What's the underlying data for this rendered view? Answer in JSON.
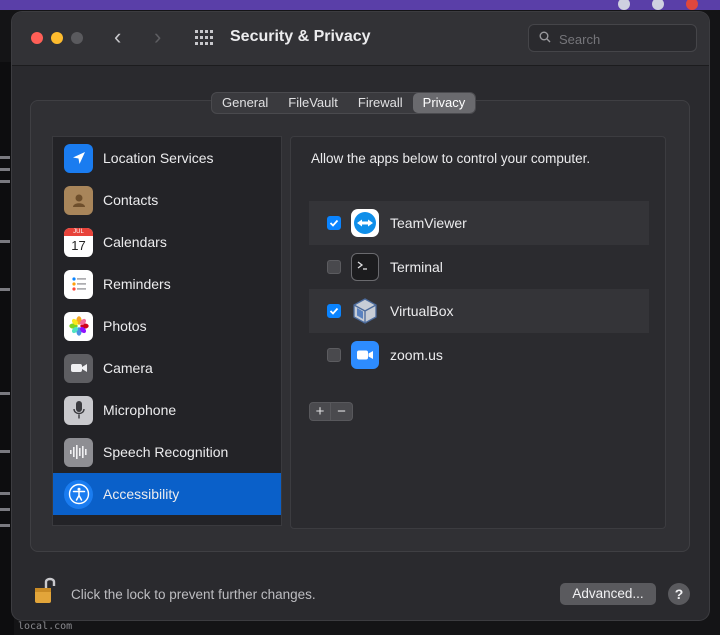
{
  "window": {
    "title": "Security & Privacy",
    "search_placeholder": "Search"
  },
  "tabs": [
    {
      "label": "General",
      "active": false
    },
    {
      "label": "FileVault",
      "active": false
    },
    {
      "label": "Firewall",
      "active": false
    },
    {
      "label": "Privacy",
      "active": true
    }
  ],
  "sidebar": {
    "items": [
      {
        "label": "Location Services",
        "icon": "location-arrow-icon"
      },
      {
        "label": "Contacts",
        "icon": "contacts-icon"
      },
      {
        "label": "Calendars",
        "icon": "calendar-icon",
        "icon_text": "17",
        "icon_month": "JUL"
      },
      {
        "label": "Reminders",
        "icon": "reminders-icon"
      },
      {
        "label": "Photos",
        "icon": "photos-icon"
      },
      {
        "label": "Camera",
        "icon": "camera-icon"
      },
      {
        "label": "Microphone",
        "icon": "microphone-icon"
      },
      {
        "label": "Speech Recognition",
        "icon": "waveform-icon"
      },
      {
        "label": "Accessibility",
        "icon": "accessibility-icon",
        "selected": true
      }
    ]
  },
  "panel": {
    "title": "Allow the apps below to control your computer.",
    "apps": [
      {
        "label": "TeamViewer",
        "checked": true,
        "icon": "teamviewer-icon"
      },
      {
        "label": "Terminal",
        "checked": false,
        "icon": "terminal-icon"
      },
      {
        "label": "VirtualBox",
        "checked": true,
        "icon": "virtualbox-icon"
      },
      {
        "label": "zoom.us",
        "checked": false,
        "icon": "zoom-icon"
      }
    ],
    "add_label": "+",
    "remove_label": "−"
  },
  "footer": {
    "lock_text": "Click the lock to prevent further changes.",
    "advanced_label": "Advanced...",
    "help_label": "?"
  },
  "background": {
    "snippet": "local.com"
  },
  "colors": {
    "accent": "#0a60c9",
    "checkbox_on": "#0a84ff",
    "window_bg": "#2a2a2e"
  }
}
